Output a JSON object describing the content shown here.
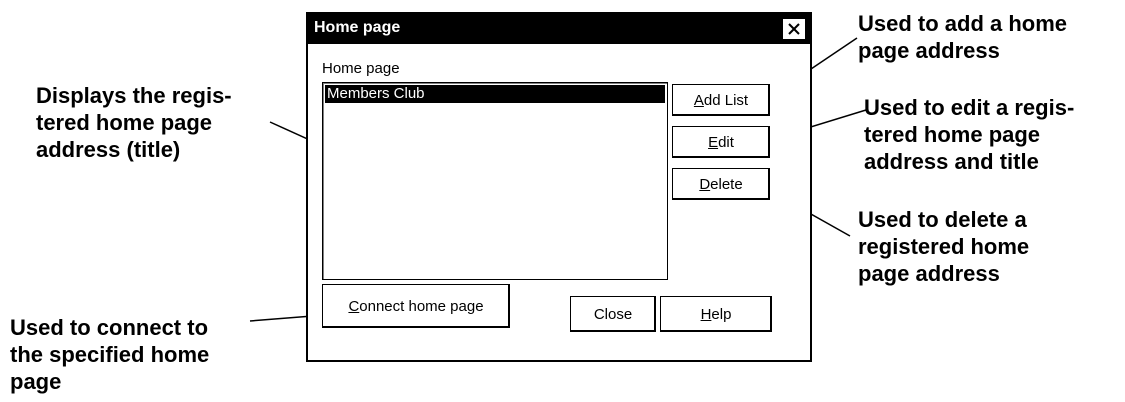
{
  "dialog": {
    "title": "Home page",
    "list_label": "Home page",
    "list_items": [
      "Members Club"
    ],
    "buttons": {
      "add_list": {
        "mnemonic": "A",
        "rest": "dd List"
      },
      "edit": {
        "mnemonic": "E",
        "rest": "dit"
      },
      "delete": {
        "mnemonic": "D",
        "rest": "elete"
      },
      "connect": {
        "mnemonic": "C",
        "rest": "onnect home page"
      },
      "close": "Close",
      "help": {
        "mnemonic": "H",
        "rest": "elp"
      }
    }
  },
  "callouts": {
    "list": [
      "Displays the regis-",
      "tered home page",
      "address (title)"
    ],
    "add": [
      "Used to add a home",
      "page address"
    ],
    "edit": [
      "Used to edit a regis-",
      "tered home page",
      "address and title"
    ],
    "delete": [
      "Used to delete a",
      "registered home",
      "page address"
    ],
    "connect": [
      "Used to connect to",
      "the specified home",
      "page"
    ]
  },
  "icons": {
    "close": "close-icon"
  }
}
